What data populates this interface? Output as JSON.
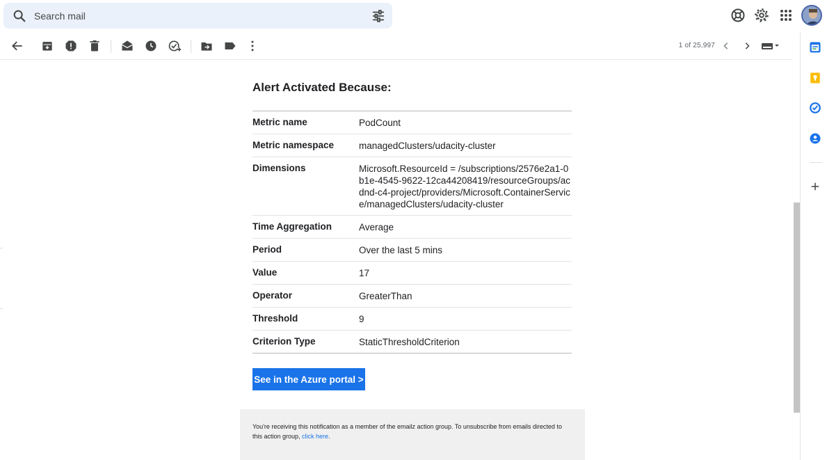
{
  "search": {
    "placeholder": "Search mail"
  },
  "toolbar": {
    "pager_text": "1 of 25,997"
  },
  "email": {
    "heading": "Alert Activated Because:",
    "rows": [
      {
        "key": "Metric name",
        "value": "PodCount"
      },
      {
        "key": "Metric namespace",
        "value": "managedClusters/udacity-cluster"
      },
      {
        "key": "Dimensions",
        "value": "Microsoft.ResourceId = /subscriptions/2576e2a1-0b1e-4545-9622-12ca44208419/resourceGroups/acdnd-c4-project/providers/Microsoft.ContainerService/managedClusters/udacity-cluster"
      },
      {
        "key": "Time Aggregation",
        "value": "Average"
      },
      {
        "key": "Period",
        "value": "Over the last 5 mins"
      },
      {
        "key": "Value",
        "value": "17"
      },
      {
        "key": "Operator",
        "value": "GreaterThan"
      },
      {
        "key": "Threshold",
        "value": "9"
      },
      {
        "key": "Criterion Type",
        "value": "StaticThresholdCriterion"
      }
    ],
    "portal_button": "See in the Azure portal >",
    "footer_text": "You're receiving this notification as a member of the emailz action group. To unsubscribe from emails directed to this action group, ",
    "footer_link": "click here",
    "footer_end": "."
  },
  "colors": {
    "accent": "#1a73e8",
    "search_bg": "#eaf1fb",
    "footer_bg": "#f0f0f0"
  },
  "icons": {
    "top": [
      "search-icon",
      "tune-icon",
      "help-icon",
      "settings-icon",
      "apps-icon",
      "avatar"
    ],
    "toolbar": [
      "back-arrow-icon",
      "archive-icon",
      "report-spam-icon",
      "delete-icon",
      "mark-unread-icon",
      "snooze-icon",
      "add-task-icon",
      "move-to-icon",
      "label-icon",
      "more-vert-icon",
      "chevron-left-icon",
      "chevron-right-icon",
      "keyboard-icon"
    ],
    "sidepanel": [
      "calendar-icon",
      "keep-icon",
      "tasks-icon",
      "contacts-icon",
      "add-icon"
    ]
  }
}
